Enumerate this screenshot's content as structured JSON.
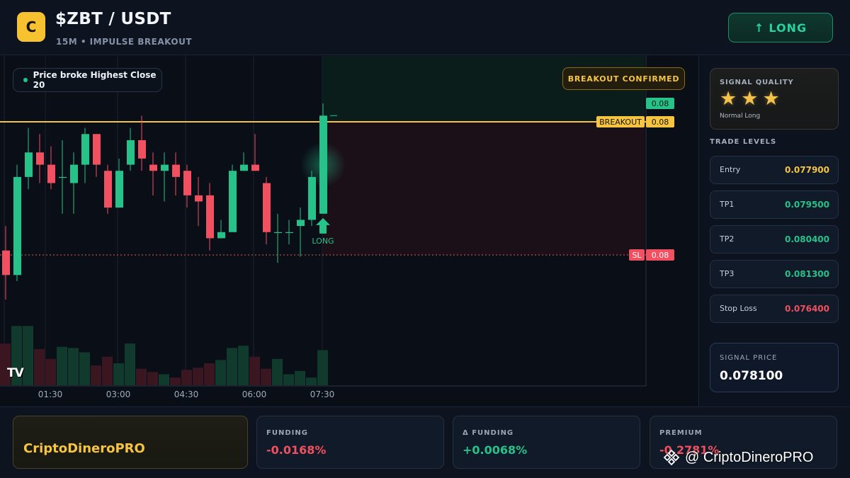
{
  "header": {
    "logo_letter": "C",
    "pair": "$ZBT / USDT",
    "subtitle": "15M • IMPULSE BREAKOUT",
    "action_arrow": "↑",
    "action_label": "LONG"
  },
  "chart": {
    "note": "Price broke Highest Close 20",
    "badge": "BREAKOUT CONFIRMED",
    "signal_marker": "LONG",
    "tv_logo": "TV",
    "price_tags": {
      "top": "0.08",
      "breakout_label": "BREAKOUT",
      "breakout_value": "0.08",
      "sl_label": "SL",
      "sl_value": "0.08"
    },
    "time_labels": [
      "01:30",
      "03:00",
      "04:30",
      "06:00",
      "07:30"
    ],
    "colors": {
      "up": "#26c28a",
      "down": "#f0505f",
      "breakout": "#f5c542",
      "sl": "#f0505f"
    }
  },
  "chart_data": {
    "type": "candlestick",
    "timeframe": "15M",
    "x_ticks": [
      "01:30",
      "03:00",
      "04:30",
      "06:00",
      "07:30"
    ],
    "levels": {
      "breakout": 0.08,
      "stop_loss": 0.08
    },
    "candles": [
      {
        "o": 0.0772,
        "h": 0.0776,
        "l": 0.0764,
        "c": 0.0768
      },
      {
        "o": 0.0768,
        "h": 0.0786,
        "l": 0.0767,
        "c": 0.0784
      },
      {
        "o": 0.0784,
        "h": 0.0792,
        "l": 0.0782,
        "c": 0.0788
      },
      {
        "o": 0.0788,
        "h": 0.0791,
        "l": 0.0783,
        "c": 0.0786
      },
      {
        "o": 0.0786,
        "h": 0.0789,
        "l": 0.0782,
        "c": 0.0783
      },
      {
        "o": 0.0784,
        "h": 0.079,
        "l": 0.0778,
        "c": 0.0784
      },
      {
        "o": 0.0783,
        "h": 0.0788,
        "l": 0.0778,
        "c": 0.0786
      },
      {
        "o": 0.0786,
        "h": 0.0792,
        "l": 0.0783,
        "c": 0.0791
      },
      {
        "o": 0.0791,
        "h": 0.0791,
        "l": 0.0784,
        "c": 0.0786
      },
      {
        "o": 0.0785,
        "h": 0.0786,
        "l": 0.0778,
        "c": 0.0779
      },
      {
        "o": 0.0779,
        "h": 0.0787,
        "l": 0.0779,
        "c": 0.0785
      },
      {
        "o": 0.0786,
        "h": 0.0792,
        "l": 0.0785,
        "c": 0.079
      },
      {
        "o": 0.079,
        "h": 0.0794,
        "l": 0.0785,
        "c": 0.0787
      },
      {
        "o": 0.0786,
        "h": 0.0788,
        "l": 0.0781,
        "c": 0.0785
      },
      {
        "o": 0.0785,
        "h": 0.0788,
        "l": 0.078,
        "c": 0.0786
      },
      {
        "o": 0.0786,
        "h": 0.0788,
        "l": 0.0781,
        "c": 0.0784
      },
      {
        "o": 0.0785,
        "h": 0.0786,
        "l": 0.0779,
        "c": 0.0781
      },
      {
        "o": 0.0781,
        "h": 0.0784,
        "l": 0.0776,
        "c": 0.078
      },
      {
        "o": 0.0781,
        "h": 0.0783,
        "l": 0.0772,
        "c": 0.0774
      },
      {
        "o": 0.0774,
        "h": 0.0777,
        "l": 0.0774,
        "c": 0.0775
      },
      {
        "o": 0.0775,
        "h": 0.0786,
        "l": 0.0775,
        "c": 0.0785
      },
      {
        "o": 0.0785,
        "h": 0.0788,
        "l": 0.0785,
        "c": 0.0786
      },
      {
        "o": 0.0786,
        "h": 0.0791,
        "l": 0.0785,
        "c": 0.0785
      },
      {
        "o": 0.0783,
        "h": 0.0784,
        "l": 0.0773,
        "c": 0.0775
      },
      {
        "o": 0.0775,
        "h": 0.0778,
        "l": 0.077,
        "c": 0.0775
      },
      {
        "o": 0.0775,
        "h": 0.0777,
        "l": 0.0773,
        "c": 0.0775
      },
      {
        "o": 0.0776,
        "h": 0.0779,
        "l": 0.0771,
        "c": 0.0777
      },
      {
        "o": 0.0777,
        "h": 0.0785,
        "l": 0.0776,
        "c": 0.0784
      },
      {
        "o": 0.0778,
        "h": 0.0796,
        "l": 0.0778,
        "c": 0.0794
      }
    ],
    "volumes": [
      38,
      54,
      54,
      33,
      24,
      35,
      34,
      30,
      18,
      26,
      20,
      38,
      15,
      12,
      10,
      7,
      14,
      16,
      20,
      23,
      34,
      36,
      26,
      15,
      24,
      10,
      13,
      7,
      32
    ]
  },
  "signal_quality": {
    "title": "SIGNAL QUALITY",
    "stars": 3,
    "max_stars": 3,
    "star_glyph": "★",
    "subtitle": "Normal Long"
  },
  "trade_levels": {
    "title": "TRADE LEVELS",
    "items": [
      {
        "name": "Entry",
        "value": "0.077900",
        "color": "#f5c542"
      },
      {
        "name": "TP1",
        "value": "0.079500",
        "color": "#26c28a"
      },
      {
        "name": "TP2",
        "value": "0.080400",
        "color": "#26c28a"
      },
      {
        "name": "TP3",
        "value": "0.081300",
        "color": "#26c28a"
      },
      {
        "name": "Stop Loss",
        "value": "0.076400",
        "color": "#f0505f"
      }
    ]
  },
  "signal_price": {
    "label": "SIGNAL PRICE",
    "value": "0.078100"
  },
  "bottom": {
    "brand": "CriptoDineroPRO",
    "stats": [
      {
        "label": "FUNDING",
        "value": "-0.0168%",
        "color": "#f0505f"
      },
      {
        "label": "Δ FUNDING",
        "value": "+0.0068%",
        "color": "#26c28a"
      },
      {
        "label": "PREMIUM",
        "value": "-0.2781%",
        "color": "#f0505f"
      }
    ],
    "watermark": "@ CriptoDineroPRO"
  }
}
